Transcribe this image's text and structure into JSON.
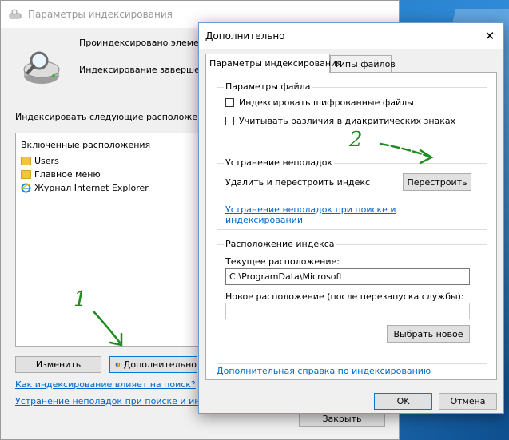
{
  "back_window": {
    "title": "Параметры индексирования",
    "indexed_text": "Проиндексировано элементов",
    "status_text": "Индексирование завершено.",
    "locations_label": "Индексировать следующие расположения:",
    "locations_header": "Включенные расположения",
    "locations": [
      {
        "name": "Users",
        "icon": "folder-icon"
      },
      {
        "name": "Главное меню",
        "icon": "folder-icon"
      },
      {
        "name": "Журнал Internet Explorer",
        "icon": "internet-explorer-icon"
      }
    ],
    "modify_button": "Изменить",
    "advanced_button": "Дополнительно",
    "link_search": "Как индексирование влияет на поиск?",
    "link_troubleshoot": "Устранение неполадок при поиске и индекс",
    "close_button": "Закрыть"
  },
  "dialog": {
    "title": "Дополнительно",
    "tabs": [
      {
        "label": "Параметры индексирования",
        "active": true
      },
      {
        "label": "Типы файлов",
        "active": false
      }
    ],
    "file_settings": {
      "title": "Параметры файла",
      "options": [
        {
          "label": "Индексировать шифрованные файлы",
          "checked": false
        },
        {
          "label": "Учитывать различия в диакритических знаках",
          "checked": false
        }
      ]
    },
    "troubleshooting": {
      "title": "Устранение неполадок",
      "rebuild_label": "Удалить и перестроить индекс",
      "rebuild_button": "Перестроить",
      "link_line1": "Устранение неполадок при поиске и",
      "link_line2": "индексировании"
    },
    "index_location": {
      "title": "Расположение индекса",
      "current_label": "Текущее расположение:",
      "current_value": "C:\\ProgramData\\Microsoft",
      "new_label": "Новое расположение (после перезапуска службы):",
      "new_value": "",
      "select_button": "Выбрать новое"
    },
    "help_link": "Дополнительная справка по индексированию",
    "ok_button": "OK",
    "cancel_button": "Отмена"
  },
  "annotations": {
    "step1": "1",
    "step2": "2",
    "color": "#1e8c1e"
  }
}
